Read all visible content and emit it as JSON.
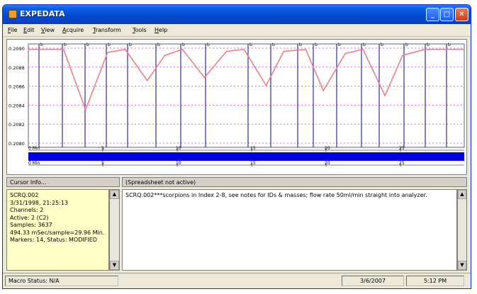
{
  "window": {
    "title": "EXPEDATA"
  },
  "menu": [
    "File",
    "Edit",
    "View",
    "Acquire",
    "Transform",
    "Tools",
    "Help"
  ],
  "chart": {
    "y_ticks": [
      "0.2090",
      "0.2088",
      "0.2086",
      "0.2084",
      "0.2082",
      "0.2080"
    ],
    "marker_label": "b",
    "ruler_top_label": "0 Min",
    "ruler_bottom_label": "0 Min",
    "ruler_ticks": [
      "5",
      "10",
      "15",
      "20",
      "25"
    ],
    "trace_color": "#f08080",
    "marker_color": "#3030a0",
    "band_color": "#0000e0"
  },
  "chart_data": {
    "type": "line",
    "title": "",
    "ylim": [
      0.208,
      0.209
    ],
    "x": [
      0,
      4,
      8,
      13,
      18,
      22,
      27,
      31,
      35,
      40,
      45,
      49,
      54,
      58,
      63,
      67,
      72,
      76,
      81,
      85,
      90,
      94,
      99
    ],
    "series": [
      {
        "values": [
          0.20896,
          0.20896,
          0.20896,
          0.20836,
          0.20893,
          0.20896,
          0.20865,
          0.2089,
          0.20896,
          0.20868,
          0.20894,
          0.20896,
          0.2086,
          0.20894,
          0.20896,
          0.20855,
          0.20892,
          0.20896,
          0.2085,
          0.2089,
          0.20896,
          0.20896,
          0.20896
        ]
      }
    ]
  },
  "panels": {
    "cursor_header": "Cursor Info...",
    "sheet_header": "(Spreadsheet not active)",
    "cursor_lines": [
      "SCRQ.002",
      "3/31/1998, 21:25:13",
      "Channels: 2",
      "Active: 2 (C2)",
      "Samples: 3637",
      "494.33 mSec/sample=29.96 Min.",
      "Markers: 14, Status: MODIFIED"
    ],
    "sheet_text": "SCRQ.002***scorpions in Index 2-8, see notes for IDs & masses; flow rate 50ml/min straight into analyzer."
  },
  "status": {
    "macro": "Macro Status: N/A",
    "date": "3/6/2007",
    "time": "5:12 PM"
  }
}
